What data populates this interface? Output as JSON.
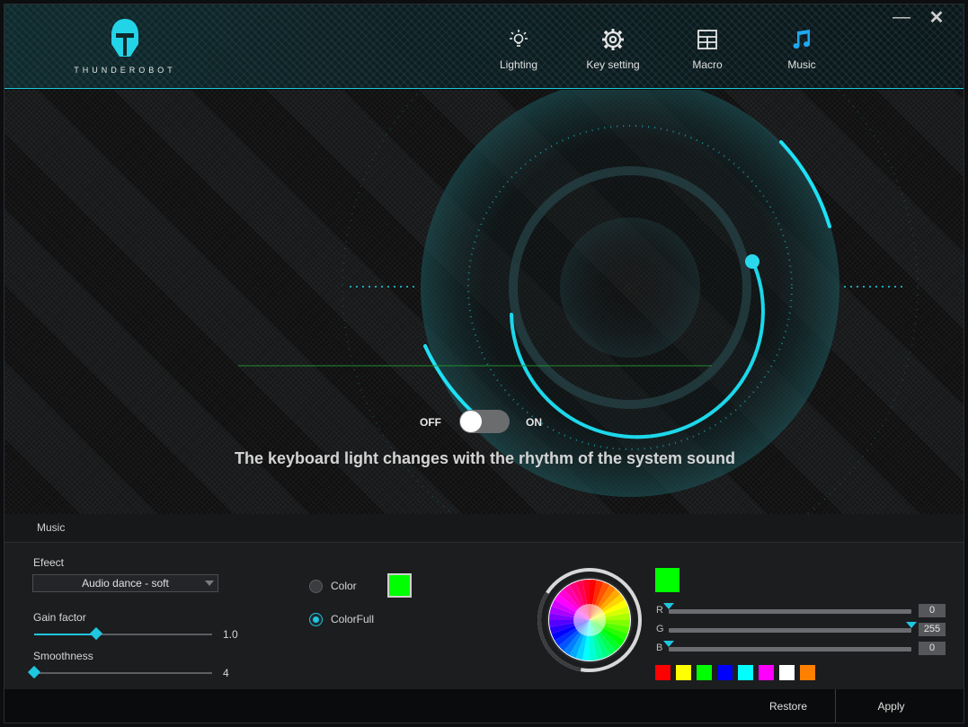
{
  "brand": {
    "name": "THUNDEROBOT"
  },
  "nav": {
    "items": [
      {
        "label": "Lighting",
        "icon": "lightbulb-icon"
      },
      {
        "label": "Key setting",
        "icon": "gear-icon"
      },
      {
        "label": "Macro",
        "icon": "grid-icon"
      },
      {
        "label": "Music",
        "icon": "music-note-icon"
      }
    ],
    "active": "Music"
  },
  "window_controls": {
    "minimize": "—",
    "close": "✕"
  },
  "hero": {
    "toggle": {
      "off_label": "OFF",
      "on_label": "ON",
      "state": "off"
    },
    "caption": "The keyboard light changes with the rhythm of the system sound"
  },
  "panel": {
    "title": "Music",
    "effect": {
      "label": "Efeect",
      "value": "Audio dance - soft"
    },
    "gain": {
      "label": "Gain factor",
      "value": "1.0",
      "level": 0.35
    },
    "smoothness": {
      "label": "Smoothness",
      "value": "4",
      "level": 0.0
    },
    "color_mode": {
      "options": [
        {
          "label": "Color",
          "selected": false
        },
        {
          "label": "ColorFull",
          "selected": true
        }
      ],
      "swatch": "#00ff00"
    },
    "rgb": {
      "preview": "#00ff00",
      "r": {
        "letter": "R",
        "value": "0",
        "level": 0.0
      },
      "g": {
        "letter": "G",
        "value": "255",
        "level": 1.0
      },
      "b": {
        "letter": "B",
        "value": "0",
        "level": 0.0
      }
    },
    "presets": [
      "#ff0000",
      "#ffff00",
      "#00ff00",
      "#0000ff",
      "#00ffff",
      "#ff00ff",
      "#ffffff",
      "#ff8000"
    ]
  },
  "footer": {
    "restore": "Restore",
    "apply": "Apply"
  },
  "colors": {
    "accent": "#1fc6df",
    "background": "#101214"
  }
}
